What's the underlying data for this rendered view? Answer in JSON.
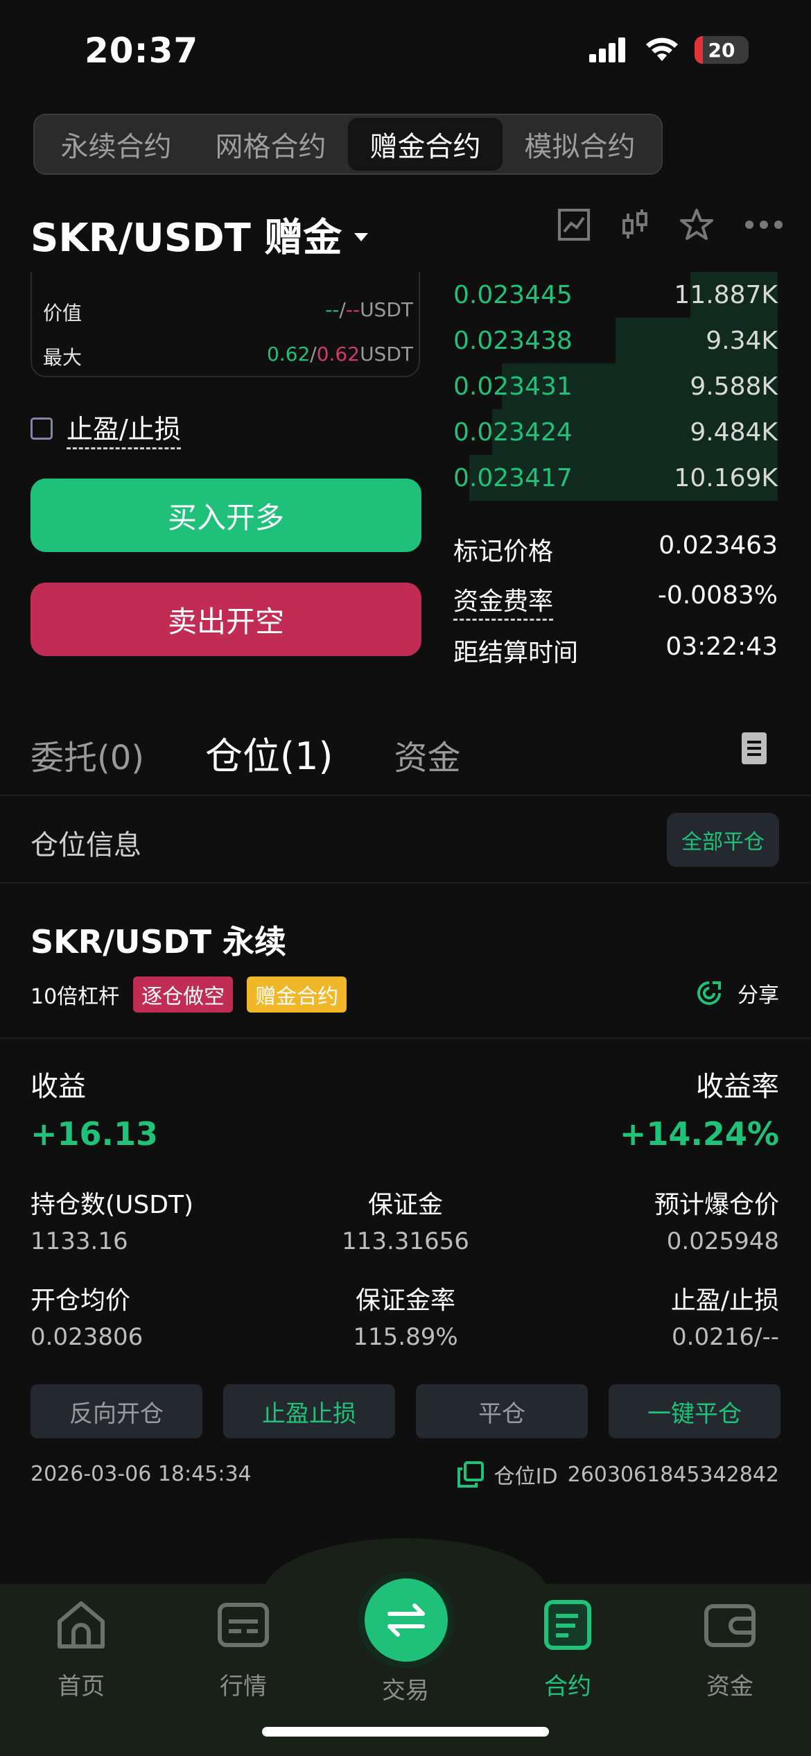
{
  "status": {
    "time": "20:37",
    "battery": "20"
  },
  "tabs": [
    {
      "label": "永续合约"
    },
    {
      "label": "网格合约"
    },
    {
      "label": "赠金合约",
      "active": true
    },
    {
      "label": "模拟合约"
    }
  ],
  "pair": {
    "name": "SKR/USDT 赠金"
  },
  "value_box": {
    "value_label": "价值",
    "value_left": "--",
    "value_sep": "/",
    "value_right": "--",
    "value_unit": "USDT",
    "max_label": "最大",
    "max_left": "0.62",
    "max_sep": "/",
    "max_right": "0.62",
    "max_unit": "USDT"
  },
  "tpsl_label": "止盈/止损",
  "buttons": {
    "buy": "买入开多",
    "sell": "卖出开空"
  },
  "order_book": [
    {
      "price": "0.023445",
      "qty": "11.887K",
      "depth": 0.27
    },
    {
      "price": "0.023438",
      "qty": "9.34K",
      "depth": 0.5
    },
    {
      "price": "0.023431",
      "qty": "9.588K",
      "depth": 0.85
    },
    {
      "price": "0.023424",
      "qty": "9.484K",
      "depth": 0.88
    },
    {
      "price": "0.023417",
      "qty": "10.169K",
      "depth": 0.95
    }
  ],
  "market_info": {
    "mark_label": "标记价格",
    "mark_value": "0.023463",
    "funding_label": "资金费率",
    "funding_value": "-0.0083%",
    "settle_label": "距结算时间",
    "settle_value": "03:22:43"
  },
  "position_tabs": [
    {
      "label": "委托(0)"
    },
    {
      "label": "仓位(1)",
      "active": true
    },
    {
      "label": "资金"
    }
  ],
  "section": {
    "title": "仓位信息",
    "close_all": "全部平仓"
  },
  "position": {
    "title": "SKR/USDT 永续",
    "leverage": "10倍杠杆",
    "tag_mode": "逐仓做空",
    "tag_type": "赠金合约",
    "share": "分享",
    "pnl_label": "收益",
    "pnl_value": "+16.13",
    "roe_label": "收益率",
    "roe_value": "+14.24%",
    "size_label": "持仓数(USDT)",
    "size_value": "1133.16",
    "margin_label": "保证金",
    "margin_value": "113.31656",
    "liq_label": "预计爆仓价",
    "liq_value": "0.025948",
    "entry_label": "开仓均价",
    "entry_value": "0.023806",
    "margin_rate_label": "保证金率",
    "margin_rate_value": "115.89%",
    "tpsl_label": "止盈/止损",
    "tpsl_value": "0.0216/--",
    "actions": {
      "reverse": "反向开仓",
      "tpsl": "止盈止损",
      "close": "平仓",
      "quick_close": "一键平仓"
    },
    "timestamp": "2026-03-06 18:45:34",
    "id_label": "仓位ID",
    "id_value": "2603061845342842"
  },
  "nav": [
    {
      "label": "首页",
      "icon": "home-icon"
    },
    {
      "label": "行情",
      "icon": "market-icon"
    },
    {
      "label": "交易",
      "icon": "swap-icon"
    },
    {
      "label": "合约",
      "icon": "contract-icon",
      "active": true
    },
    {
      "label": "资金",
      "icon": "wallet-icon"
    }
  ],
  "colors": {
    "green": "#1ec279",
    "red": "#c02c53",
    "yellow": "#f0b829",
    "bg": "#0f0f0f"
  }
}
